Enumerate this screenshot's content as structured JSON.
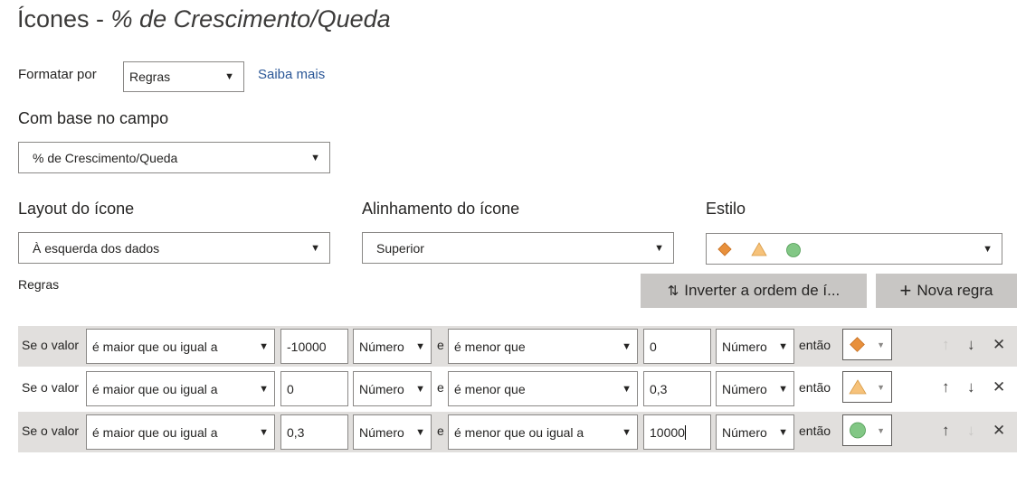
{
  "title": {
    "prefix": "Ícones - ",
    "italic": "% de Crescimento/Queda"
  },
  "format": {
    "label": "Formatar por",
    "value": "Regras",
    "learn_more": "Saiba mais"
  },
  "field": {
    "label": "Com base no campo",
    "value": "% de Crescimento/Queda"
  },
  "layout": {
    "label": "Layout do ícone",
    "value": "À esquerda dos dados"
  },
  "alignment": {
    "label": "Alinhamento do ícone",
    "value": "Superior"
  },
  "style": {
    "label": "Estilo",
    "icons": [
      "diamond-icon",
      "triangle-icon",
      "circle-icon"
    ]
  },
  "rules_label": "Regras",
  "buttons": {
    "invert": "Inverter a ordem de í...",
    "new_rule": "Nova regra"
  },
  "colors": {
    "diamond": "#e8903c",
    "triangle": "#f6c27a",
    "circle": "#82c785",
    "row_bg": "#e1dfdd",
    "button_bg": "#c8c6c4"
  },
  "rows": [
    {
      "prefix": "Se o valor",
      "op1": "é maior que ou igual a",
      "val1": "-10000",
      "type1": "Número",
      "and": "e",
      "op2": "é menor que",
      "val2": "0",
      "type2": "Número",
      "then": "então",
      "icon": "diamond-icon"
    },
    {
      "prefix": "Se o valor",
      "op1": "é maior que ou igual a",
      "val1": "0",
      "type1": "Número",
      "and": "e",
      "op2": "é menor que",
      "val2": "0,3",
      "type2": "Número",
      "then": "então",
      "icon": "triangle-icon"
    },
    {
      "prefix": "Se o valor",
      "op1": "é maior que ou igual a",
      "val1": "0,3",
      "type1": "Número",
      "and": "e",
      "op2": "é menor que ou igual a",
      "val2": "10000",
      "type2": "Número",
      "then": "então",
      "icon": "circle-icon"
    }
  ]
}
